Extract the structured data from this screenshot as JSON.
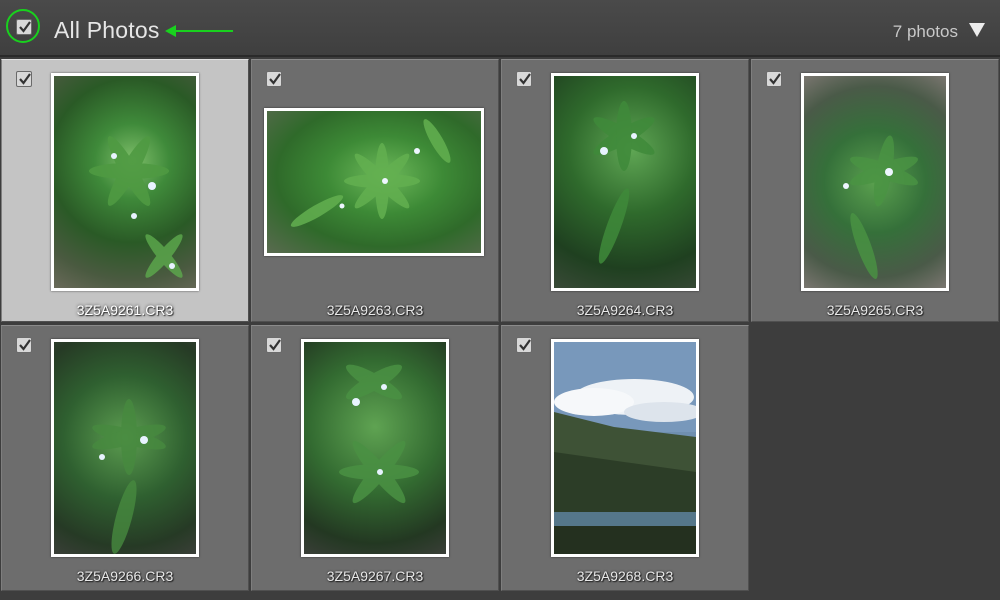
{
  "header": {
    "title": "All Photos",
    "count": "7 photos"
  },
  "photos": [
    {
      "filename": "3Z5A9261.CR3",
      "checked": true,
      "selected": true,
      "orientation": "portrait"
    },
    {
      "filename": "3Z5A9263.CR3",
      "checked": true,
      "selected": false,
      "orientation": "landscape"
    },
    {
      "filename": "3Z5A9264.CR3",
      "checked": true,
      "selected": false,
      "orientation": "portrait"
    },
    {
      "filename": "3Z5A9265.CR3",
      "checked": true,
      "selected": false,
      "orientation": "portrait"
    },
    {
      "filename": "3Z5A9266.CR3",
      "checked": true,
      "selected": false,
      "orientation": "portrait"
    },
    {
      "filename": "3Z5A9267.CR3",
      "checked": true,
      "selected": false,
      "orientation": "portrait"
    },
    {
      "filename": "3Z5A9268.CR3",
      "checked": true,
      "selected": false,
      "orientation": "portrait"
    }
  ],
  "colors": {
    "accent_annotation": "#19d11e",
    "selected_cell": "#c4c4c4",
    "cell": "#6d6d6d",
    "background": "#3d3d3d"
  },
  "icons": {
    "select_all": "checkbox-icon",
    "annotation": "arrow-left-icon",
    "menu": "triangle-down-icon"
  }
}
